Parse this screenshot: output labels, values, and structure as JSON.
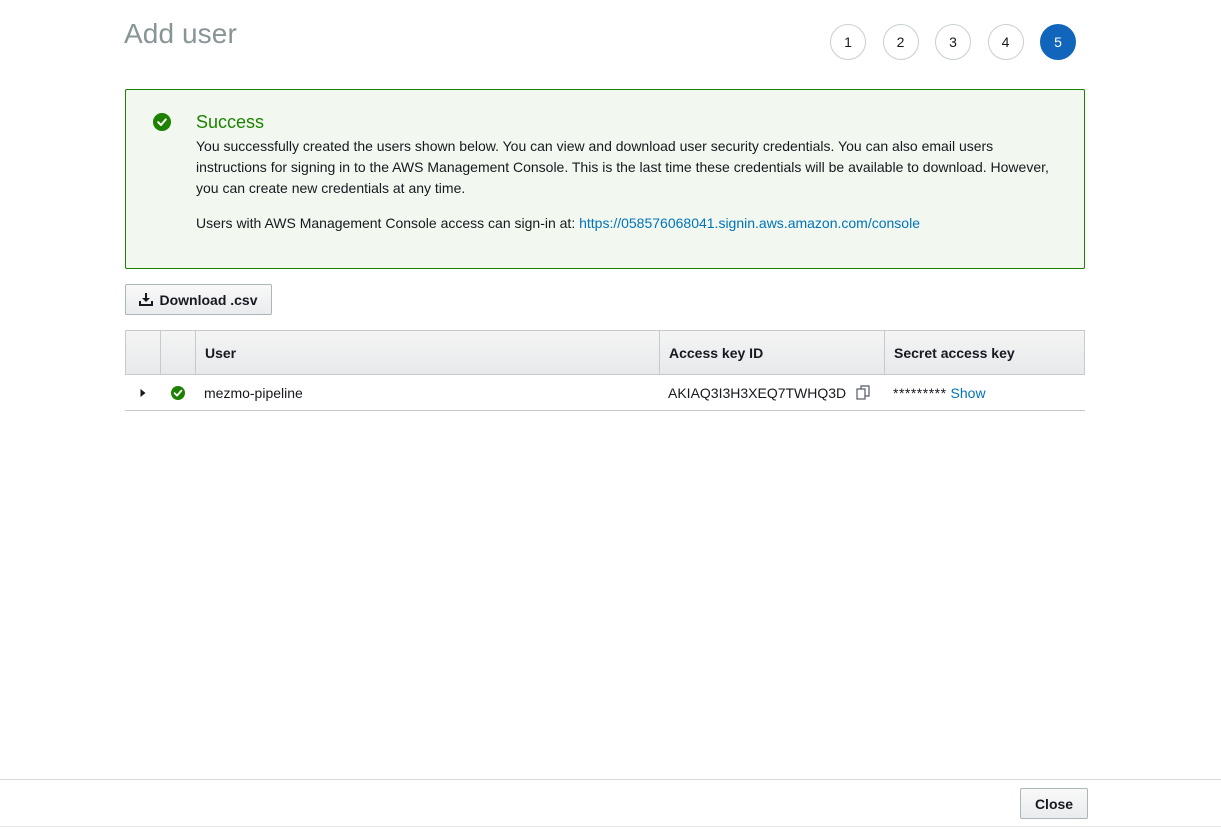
{
  "page": {
    "title": "Add user"
  },
  "steps": [
    "1",
    "2",
    "3",
    "4",
    "5"
  ],
  "active_step": "5",
  "alert": {
    "title": "Success",
    "body": "You successfully created the users shown below. You can view and download user security credentials. You can also email users instructions for signing in to the AWS Management Console. This is the last time these credentials will be available to download. However, you can create new credentials at any time.",
    "signin_text": "Users with AWS Management Console access can sign-in at:",
    "signin_url": "https://058576068041.signin.aws.amazon.com/console"
  },
  "toolbar": {
    "download_label": "Download .csv"
  },
  "table": {
    "columns": [
      "User",
      "Access key ID",
      "Secret access key"
    ],
    "rows": [
      {
        "user": "mezmo-pipeline",
        "access_key_id": "AKIAQ3I3H3XEQ7TWHQ3D",
        "secret_mask": "*********",
        "secret_show": "Show"
      }
    ]
  },
  "footer": {
    "close_label": "Close"
  },
  "colors": {
    "success": "#1d8102",
    "link": "#0073bb",
    "active_step": "#1166bb"
  }
}
